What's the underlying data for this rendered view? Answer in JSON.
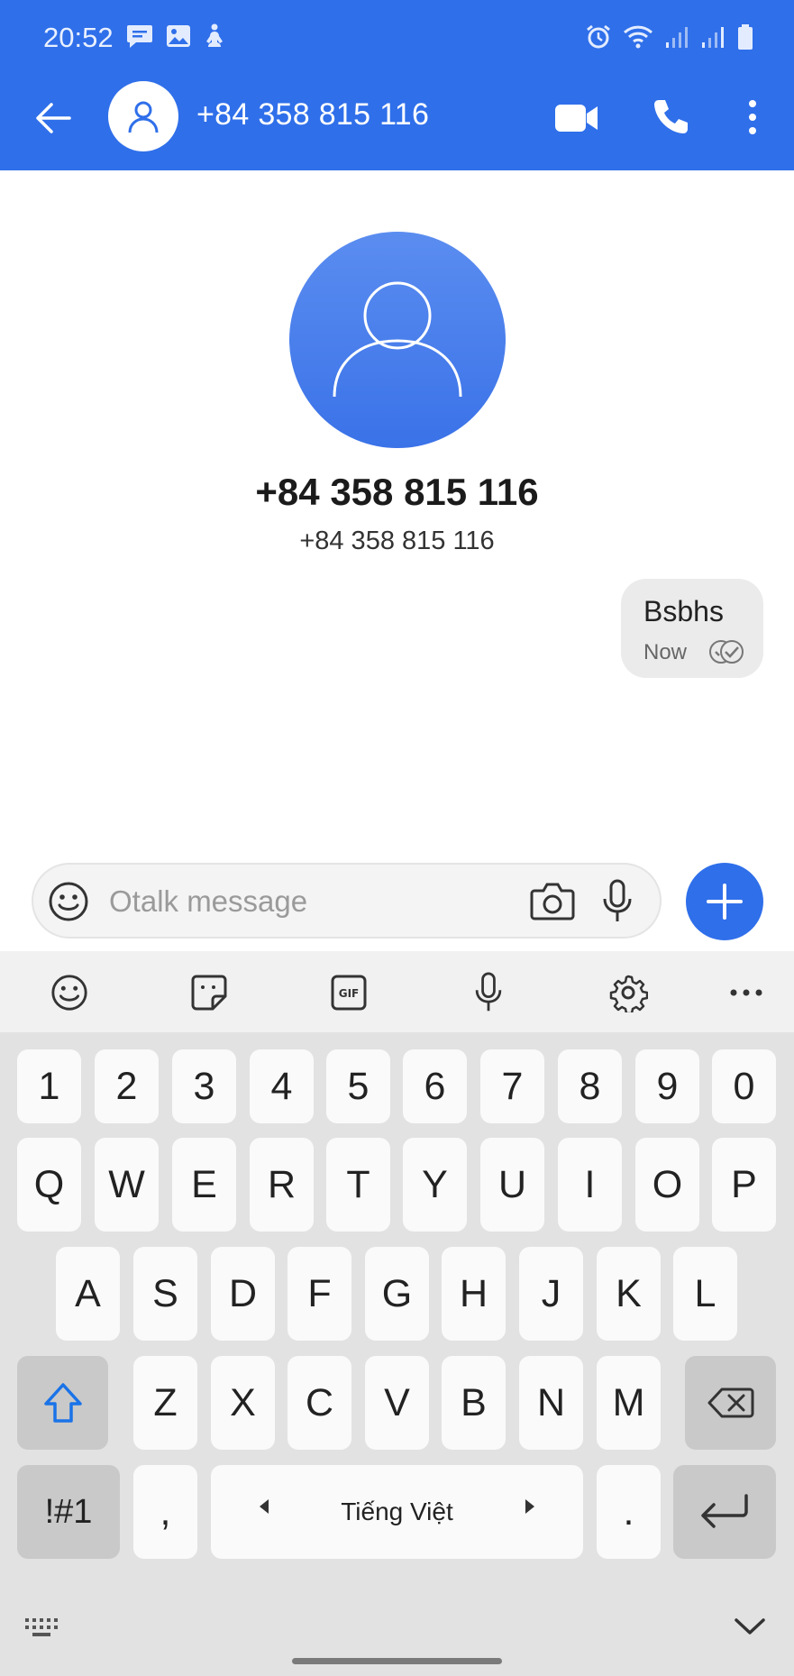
{
  "status_bar": {
    "time": "20:52",
    "icons": [
      "message-icon",
      "gallery-icon",
      "accessibility-icon",
      "alarm-icon",
      "wifi-icon",
      "signal-icon",
      "signal-icon",
      "battery-icon"
    ]
  },
  "header": {
    "title": "+84 358 815 116",
    "icons": [
      "back-arrow-icon",
      "contact-avatar-icon",
      "video-call-icon",
      "phone-icon",
      "more-vert-icon"
    ]
  },
  "contact": {
    "name": "+84 358 815 116",
    "number": "+84 358 815 116"
  },
  "messages": [
    {
      "text": "Bsbhs",
      "time": "Now",
      "status_icon": "read-receipt-icon"
    }
  ],
  "compose": {
    "placeholder": "Otalk message"
  },
  "keyboard": {
    "toolbar": [
      "emoji-icon",
      "sticker-icon",
      "gif-icon",
      "mic-icon",
      "settings-icon",
      "more-horiz-icon"
    ],
    "row_numbers": [
      "1",
      "2",
      "3",
      "4",
      "5",
      "6",
      "7",
      "8",
      "9",
      "0"
    ],
    "row1": [
      "Q",
      "W",
      "E",
      "R",
      "T",
      "Y",
      "U",
      "I",
      "O",
      "P"
    ],
    "row2": [
      "A",
      "S",
      "D",
      "F",
      "G",
      "H",
      "J",
      "K",
      "L"
    ],
    "row3": [
      "Z",
      "X",
      "C",
      "V",
      "B",
      "N",
      "M"
    ],
    "symbols_label": "!#1",
    "comma": ",",
    "space_label": "Tiếng Việt",
    "period": "."
  },
  "colors": {
    "brand": "#2f6fea",
    "bubble": "#ebebeb",
    "keyboard_bg": "#e2e2e2",
    "notification_dot": "#f26a1b"
  }
}
